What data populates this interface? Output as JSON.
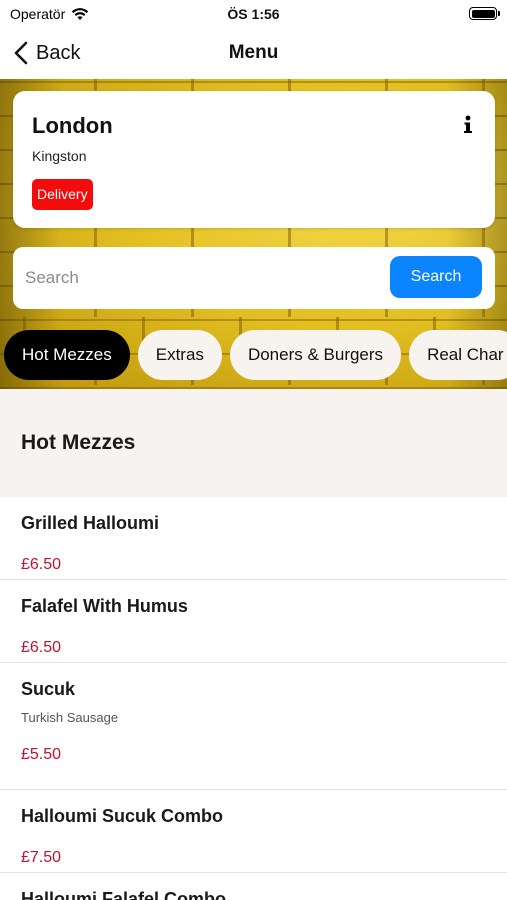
{
  "status_bar": {
    "carrier": "Operatör",
    "time": "ÖS 1:56",
    "wifi_icon": "wifi-icon",
    "battery_icon": "battery-icon",
    "battery_level": 1.0
  },
  "nav": {
    "back_label": "Back",
    "title": "Menu",
    "back_icon": "chevron-left-icon"
  },
  "store": {
    "name": "London",
    "area": "Kingston",
    "badge": "Delivery",
    "badge_color": "#f40b0b",
    "info_icon": "info-icon"
  },
  "search": {
    "placeholder": "Search",
    "value": "",
    "button_label": "Search",
    "button_color": "#0a84ff"
  },
  "categories": [
    {
      "label": "Hot Mezzes",
      "active": true
    },
    {
      "label": "Extras",
      "active": false
    },
    {
      "label": "Doners & Burgers",
      "active": false
    },
    {
      "label": "Real Char",
      "active": false
    }
  ],
  "section": {
    "title": "Hot Mezzes"
  },
  "items": [
    {
      "name": "Grilled Halloumi",
      "description": "",
      "price": "£6.50"
    },
    {
      "name": "Falafel With Humus",
      "description": "",
      "price": "£6.50"
    },
    {
      "name": "Sucuk",
      "description": "Turkish Sausage",
      "price": "£5.50"
    },
    {
      "name": "Halloumi Sucuk Combo",
      "description": "",
      "price": "£7.50"
    },
    {
      "name": "Halloumi Falafel Combo",
      "description": "",
      "price": ""
    }
  ],
  "colors": {
    "price": "#c8102e",
    "active_chip": "#000000",
    "chip_bg": "#f7f3ef",
    "section_bg": "#f6f3f0",
    "hero_brick": "#d8b51a"
  }
}
